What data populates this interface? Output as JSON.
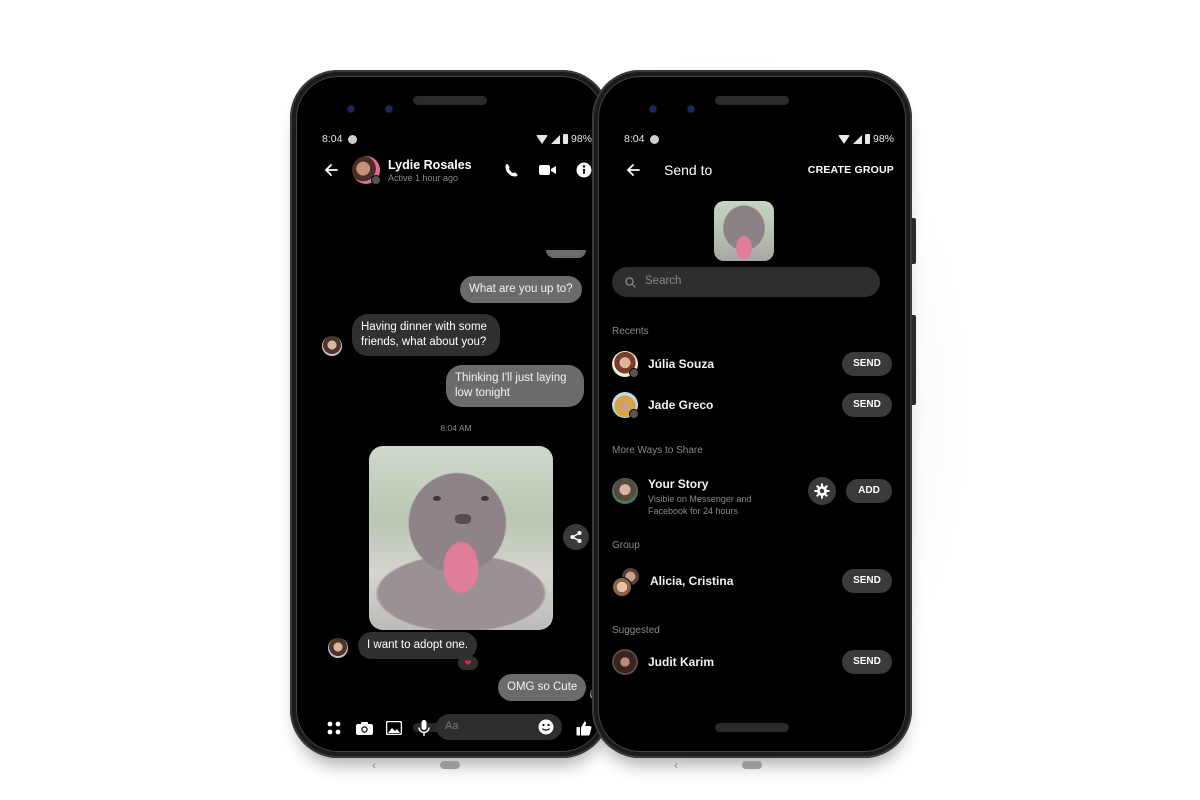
{
  "status_bar": {
    "time": "8:04",
    "battery": "98%"
  },
  "chat": {
    "contact_name": "Lydie Rosales",
    "contact_status": "Active 1 hour ago",
    "messages": [
      {
        "direction": "out",
        "text": "What are you up to?"
      },
      {
        "direction": "in",
        "text": "Having dinner with some friends, what about you?"
      },
      {
        "direction": "out",
        "text": "Thinking I'll just laying low tonight"
      },
      {
        "direction": "in",
        "text": "I want to adopt one.",
        "reaction": "❤"
      },
      {
        "direction": "out",
        "text": "OMG so Cute"
      }
    ],
    "timestamp": "8:04 AM",
    "composer_placeholder": "Aa",
    "icons": [
      "back-arrow-icon",
      "phone-icon",
      "video-icon",
      "info-icon",
      "share-icon",
      "apps-icon",
      "camera-icon",
      "image-icon",
      "mic-icon",
      "emoji-icon",
      "thumbs-up-icon"
    ]
  },
  "share": {
    "title": "Send to",
    "create_group_label": "CREATE GROUP",
    "search_placeholder": "Search",
    "sections": {
      "recents": "Recents",
      "more_ways": "More Ways to Share",
      "group": "Group",
      "suggested": "Suggested"
    },
    "recents": [
      {
        "name": "Júlia Souza",
        "action": "SEND"
      },
      {
        "name": "Jade Greco",
        "action": "SEND"
      }
    ],
    "story": {
      "name": "Your Story",
      "subtitle": "Visible on Messenger and Facebook for 24 hours",
      "action": "ADD"
    },
    "group": {
      "name": "Alicia, Cristina",
      "action": "SEND"
    },
    "suggested": [
      {
        "name": "Judit Karim",
        "action": "SEND"
      }
    ]
  },
  "nav": {
    "back_glyph": "‹"
  }
}
